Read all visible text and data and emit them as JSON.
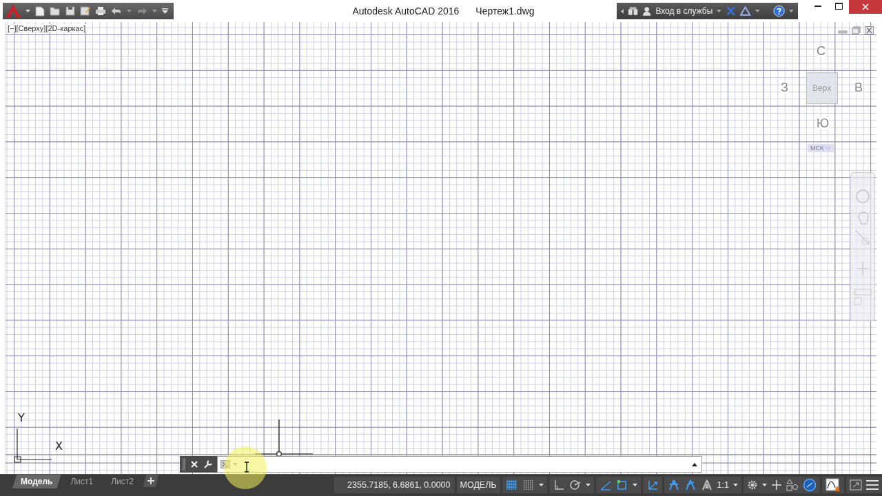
{
  "window": {
    "app_title": "Autodesk AutoCAD 2016",
    "file_name": "Чертеж1.dwg"
  },
  "infocenter": {
    "sign_in": "Вход в службы"
  },
  "viewport": {
    "controls": "[−][Сверху][2D-каркас]"
  },
  "viewcube": {
    "face": "Верх",
    "north": "С",
    "south": "Ю",
    "west": "З",
    "east": "В",
    "ucs": "МСК"
  },
  "ucs_icon": {
    "x": "X",
    "y": "Y"
  },
  "layout_tabs": [
    {
      "label": "Модель",
      "selected": true
    },
    {
      "label": "Лист1",
      "selected": false
    },
    {
      "label": "Лист2",
      "selected": false
    }
  ],
  "status_bar": {
    "coordinates": "2355.7185, 6.6861, 0.0000",
    "space": "МОДЕЛЬ",
    "scale": "1:1",
    "toggles": [
      {
        "kind": "grid",
        "on": true
      },
      {
        "kind": "snap",
        "on": false
      },
      {
        "kind": "ortho",
        "on": false
      },
      {
        "kind": "polar",
        "on": false
      },
      {
        "kind": "tracking",
        "on": true
      },
      {
        "kind": "osnap",
        "on": true
      },
      {
        "kind": "dynucs",
        "on": true
      },
      {
        "kind": "annovis",
        "on": true
      },
      {
        "kind": "autoscale",
        "on": true
      },
      {
        "kind": "annoscale",
        "on": false
      }
    ]
  }
}
